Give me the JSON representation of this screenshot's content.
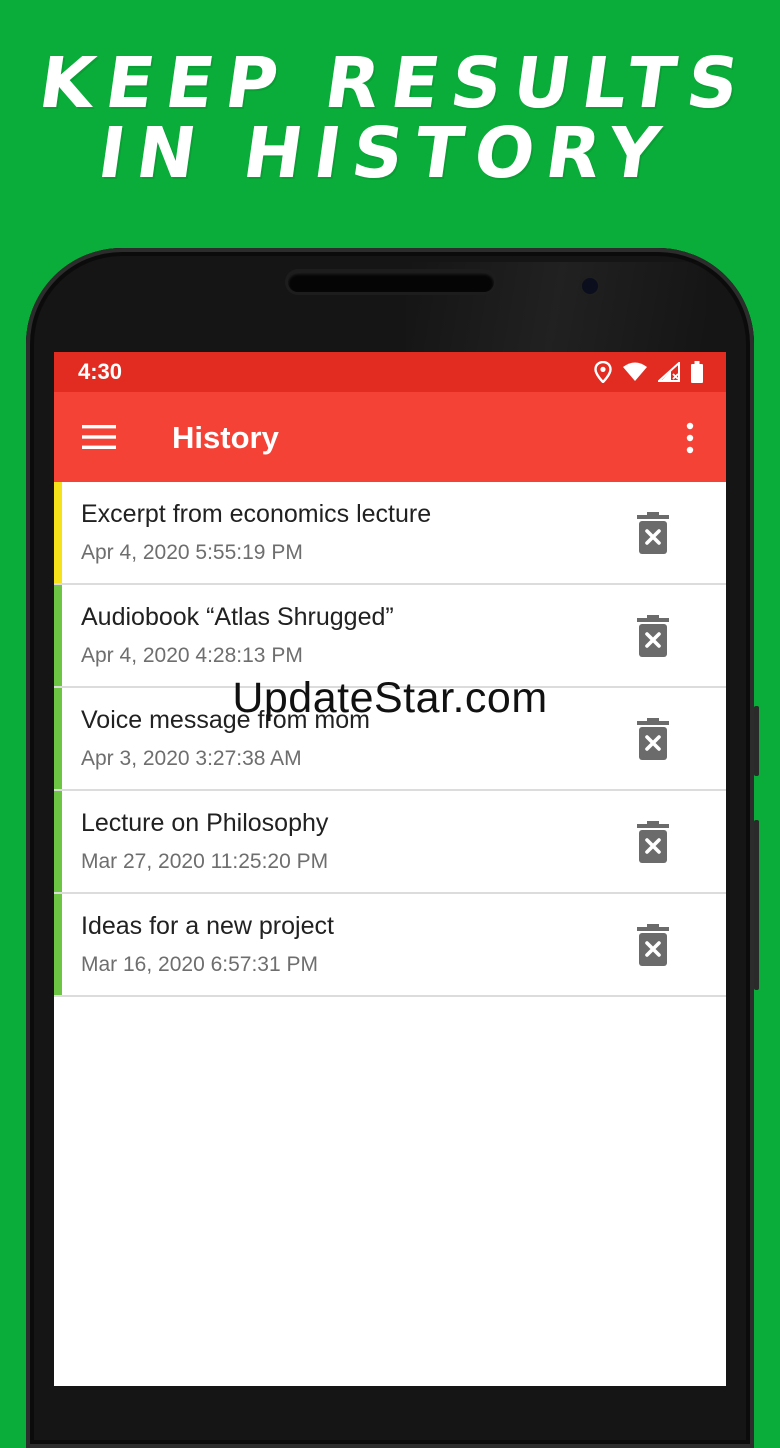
{
  "promo": {
    "line1": "KEEP RESULTS",
    "line2": "IN HISTORY"
  },
  "status_bar": {
    "time": "4:30",
    "icons": [
      "location-icon",
      "wifi-icon",
      "signal-icon",
      "battery-icon"
    ]
  },
  "app_bar": {
    "title": "History",
    "menu_icon": "hamburger-menu-icon",
    "more_icon": "more-vert-icon"
  },
  "history": [
    {
      "title": "Excerpt from economics lecture",
      "date": "Apr 4, 2020 5:55:19 PM",
      "accent": "#f5e21b"
    },
    {
      "title": "Audiobook “Atlas Shrugged”",
      "date": "Apr 4, 2020 4:28:13 PM",
      "accent": "#6cc644"
    },
    {
      "title": "Voice message from mom",
      "date": "Apr 3, 2020 3:27:38 AM",
      "accent": "#6cc644"
    },
    {
      "title": "Lecture on Philosophy",
      "date": "Mar 27, 2020 11:25:20 PM",
      "accent": "#6cc644"
    },
    {
      "title": "Ideas for a new project",
      "date": "Mar 16, 2020 6:57:31 PM",
      "accent": "#6cc644"
    }
  ],
  "watermark": "UpdateStar.com",
  "colors": {
    "background": "#0aad3a",
    "status_bar": "#e22b21",
    "app_bar": "#f44336",
    "delete_icon": "#6b6b6b"
  }
}
